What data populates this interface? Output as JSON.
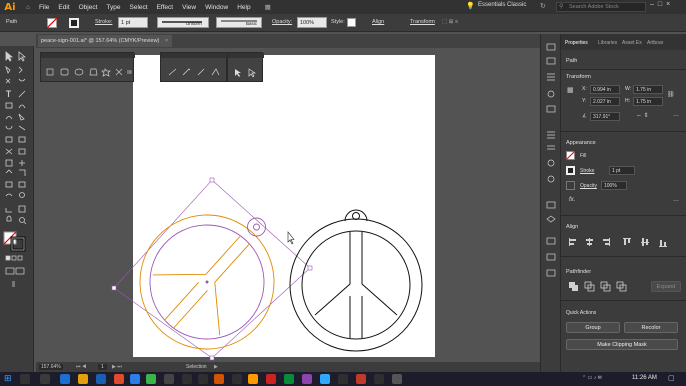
{
  "app": {
    "logo": "Ai"
  },
  "menu": [
    "File",
    "Edit",
    "Object",
    "Type",
    "Select",
    "Effect",
    "View",
    "Window",
    "Help"
  ],
  "workspace": "Essentials Classic",
  "search": {
    "placeholder": "Search Adobe Stock"
  },
  "control": {
    "selection_label": "Path",
    "stroke_label": "Stroke:",
    "stroke_value": "1 pt",
    "uniform": "Uniform",
    "basic": "Basic",
    "opacity_label": "Opacity:",
    "opacity_value": "100%",
    "style_label": "Style:",
    "align": "Align",
    "transform": "Transform"
  },
  "doc_tab": "peace-sign-001.ai* @ 157.64% (CMYK/Preview)",
  "properties": {
    "tabs": [
      "Properties",
      "Libraries",
      "Asset Ex",
      "Artboar"
    ],
    "object_type": "Path",
    "transform_header": "Transform",
    "x_label": "X:",
    "x": "0.994 in",
    "y_label": "Y:",
    "y": "2.027 in",
    "w_label": "W:",
    "w": "1.75 in",
    "h_label": "H:",
    "h": "1.75 in",
    "rotation": "317.91°",
    "appearance_header": "Appearance",
    "fill_label": "Fill",
    "stroke_label": "Stroke",
    "stroke_value": "1 pt",
    "opacity_label": "Opacity",
    "opacity_value": "100%",
    "fx": "fx.",
    "align_header": "Align",
    "pathfinder_header": "Pathfinder",
    "expand": "Expand",
    "quick_actions": "Quick Actions",
    "group_btn": "Group",
    "recolor_btn": "Recolor",
    "clipping_btn": "Make Clipping Mask"
  },
  "status": {
    "zoom": "157.64%",
    "page": "1",
    "tool": "Selection"
  },
  "taskbar": {
    "time": "11:26 AM"
  },
  "colors": {
    "accent": "#ff9a00",
    "selection": "#9b59b6",
    "path_outline": "#e08a00"
  }
}
